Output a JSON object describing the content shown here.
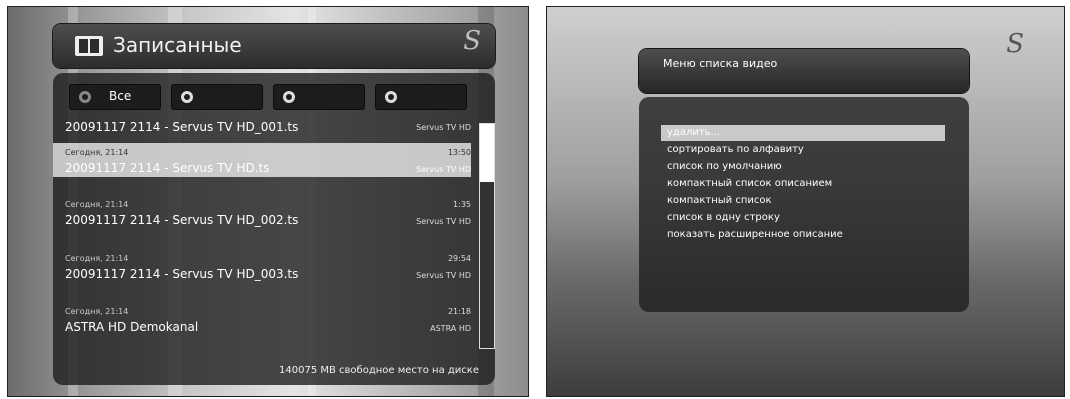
{
  "left": {
    "title": "Записанные",
    "tabs": [
      {
        "label": "Все"
      },
      {
        "label": ""
      },
      {
        "label": ""
      },
      {
        "label": ""
      }
    ],
    "recordings": [
      {
        "title": "20091117 2114 - Servus TV HD_001.ts",
        "channel": "Servus TV HD",
        "date": "",
        "duration": ""
      },
      {
        "title": "20091117 2114 - Servus TV HD.ts",
        "channel": "Servus TV HD",
        "date": "Сегодня, 21:14",
        "duration": "13:50"
      },
      {
        "title": "20091117 2114 - Servus TV HD_002.ts",
        "channel": "Servus TV HD",
        "date": "Сегодня, 21:14",
        "duration": "1:35"
      },
      {
        "title": "20091117 2114 - Servus TV HD_003.ts",
        "channel": "Servus TV HD",
        "date": "Сегодня, 21:14",
        "duration": "29:54"
      },
      {
        "title": "ASTRA HD Demokanal",
        "channel": "ASTRA HD",
        "date": "Сегодня, 21:14",
        "duration": "21:18"
      }
    ],
    "free_space": "140075 MB свободное место на диске",
    "logo_icon": "servus-logo-icon"
  },
  "right": {
    "title": "Меню списка видео",
    "menu_items": [
      "удалить...",
      "сортировать по алфавиту",
      "список по умолчанию",
      "компактный  список описанием",
      "компактный список",
      "список в одну строку",
      "показать расширенное описание"
    ],
    "selected_index": 0
  }
}
